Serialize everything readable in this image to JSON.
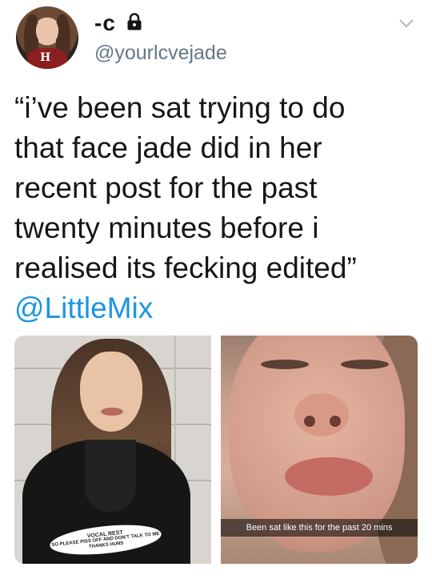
{
  "user": {
    "display_name": "-c",
    "handle": "@yourlcvejade",
    "avatar_logo": "H"
  },
  "tweet": {
    "lines": [
      "“i’ve been sat trying to do",
      "that face jade did in her",
      "recent post for the past",
      "twenty minutes before i",
      "realised its fecking edited”"
    ],
    "mention": "@LittleMix"
  },
  "media": {
    "left_caption": {
      "title": "VOCAL REST",
      "line1": "SO PLEASE PISS OFF AND DON'T TALK TO ME",
      "line2": "THANKS HUNS"
    },
    "right_caption": "Been sat like this for the past 20 mins"
  },
  "colors": {
    "text": "#14171a",
    "secondary": "#657786",
    "link": "#1b95e0"
  },
  "icons": {
    "lock": "lock-icon",
    "chevron": "chevron-down-icon"
  }
}
